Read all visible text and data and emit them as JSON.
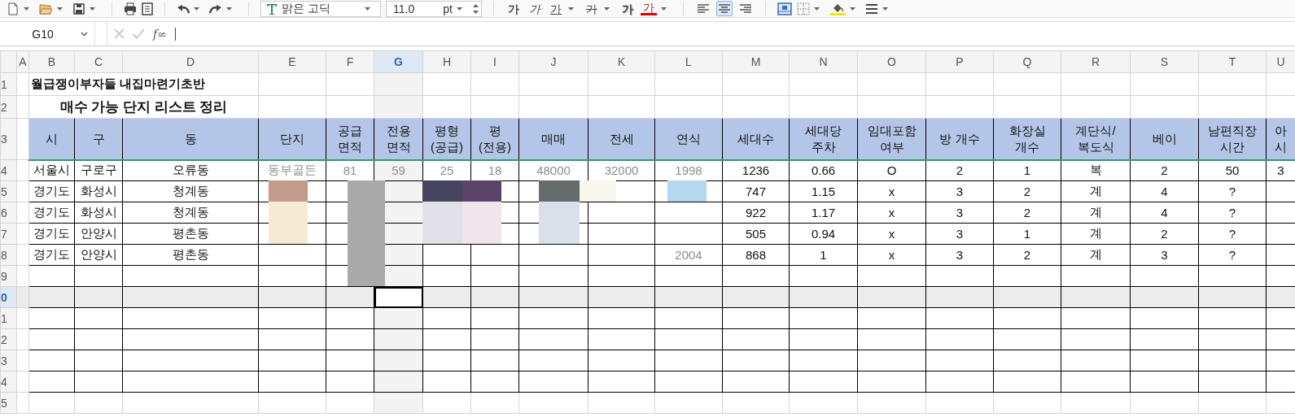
{
  "toolbar": {
    "font_name": "맑은 고딕",
    "font_size": "11.0",
    "size_unit": "pt",
    "text_style_buttons": [
      {
        "kind": "bold",
        "label": "가",
        "has_menu": false
      },
      {
        "kind": "italic",
        "label": "가",
        "has_menu": false
      },
      {
        "kind": "underline",
        "label": "가",
        "has_menu": true
      },
      {
        "kind": "strikethrough",
        "label": "가",
        "has_menu": true
      },
      {
        "kind": "shadow",
        "label": "가",
        "has_menu": false
      },
      {
        "kind": "font_color",
        "label": "가",
        "has_menu": true
      }
    ],
    "align_buttons": [
      {
        "kind": "left",
        "selected": false
      },
      {
        "kind": "center",
        "selected": true
      },
      {
        "kind": "right",
        "selected": false
      }
    ]
  },
  "formula_bar": {
    "cell_reference": "G10",
    "function_label": "f∞"
  },
  "sheet": {
    "columns": [
      {
        "label": "A",
        "selected": false
      },
      {
        "label": "B",
        "selected": false
      },
      {
        "label": "C",
        "selected": false
      },
      {
        "label": "D",
        "selected": false
      },
      {
        "label": "E",
        "selected": false
      },
      {
        "label": "F",
        "selected": false
      },
      {
        "label": "G",
        "selected": true
      },
      {
        "label": "H",
        "selected": false
      },
      {
        "label": "I",
        "selected": false
      },
      {
        "label": "J",
        "selected": false
      },
      {
        "label": "K",
        "selected": false
      },
      {
        "label": "L",
        "selected": false
      },
      {
        "label": "M",
        "selected": false
      },
      {
        "label": "N",
        "selected": false
      },
      {
        "label": "O",
        "selected": false
      },
      {
        "label": "P",
        "selected": false
      },
      {
        "label": "Q",
        "selected": false
      },
      {
        "label": "R",
        "selected": false
      },
      {
        "label": "S",
        "selected": false
      },
      {
        "label": "T",
        "selected": false
      },
      {
        "label": "U",
        "selected": false
      }
    ],
    "rows": [
      {
        "label": "1",
        "kind": "title",
        "selected": false,
        "cells": [
          null,
          "월급쟁이부자들 내집마련기초반",
          null,
          null,
          null,
          null,
          null,
          null,
          null,
          null,
          null,
          null,
          null,
          null,
          null,
          null,
          null,
          null,
          null,
          null,
          null
        ]
      },
      {
        "label": "2",
        "kind": "subtitle",
        "selected": false,
        "cells": [
          null,
          "매수 가능 단지 리스트 정리",
          null,
          null,
          null,
          null,
          null,
          null,
          null,
          null,
          null,
          null,
          null,
          null,
          null,
          null,
          null,
          null,
          null,
          null,
          null
        ]
      },
      {
        "label": "3",
        "kind": "header",
        "selected": false,
        "cells": [
          null,
          "시",
          "구",
          "동",
          "단지",
          "공급\n면적",
          "전용\n면적",
          "평형\n(공급)",
          "평\n(전용)",
          "매매",
          "전세",
          "연식",
          "세대수",
          "세대당\n주차",
          "임대포함\n여부",
          "방 개수",
          "화장실\n개수",
          "계단식/\n복도식",
          "베이",
          "남편직장\n시간",
          "아\n시"
        ]
      },
      {
        "label": "4",
        "kind": "data",
        "selected": false,
        "cells": [
          null,
          "서울시",
          "구로구",
          "오류동",
          {
            "text": "동부골든",
            "faded": true
          },
          {
            "text": "81",
            "faded": true
          },
          {
            "text": "59",
            "faded": true
          },
          {
            "text": "25",
            "faded": true
          },
          {
            "text": "18",
            "faded": true
          },
          {
            "text": "48000",
            "faded": true
          },
          {
            "text": "32000",
            "faded": true
          },
          {
            "text": "1998",
            "faded": true
          },
          "1236",
          "0.66",
          "O",
          "2",
          "1",
          "복",
          "2",
          "50",
          "3"
        ]
      },
      {
        "label": "5",
        "kind": "data",
        "selected": false,
        "cells": [
          null,
          "경기도",
          "화성시",
          "청계동",
          null,
          null,
          null,
          null,
          null,
          null,
          null,
          null,
          "747",
          "1.15",
          "x",
          "3",
          "2",
          "계",
          "4",
          "?",
          null
        ]
      },
      {
        "label": "6",
        "kind": "data",
        "selected": false,
        "cells": [
          null,
          "경기도",
          "화성시",
          "청계동",
          null,
          null,
          null,
          null,
          null,
          null,
          null,
          null,
          "922",
          "1.17",
          "x",
          "3",
          "2",
          "계",
          "4",
          "?",
          null
        ]
      },
      {
        "label": "7",
        "kind": "data",
        "selected": false,
        "cells": [
          null,
          "경기도",
          "안양시",
          "평촌동",
          null,
          null,
          null,
          null,
          null,
          null,
          null,
          null,
          "505",
          "0.94",
          "x",
          "3",
          "1",
          "계",
          "2",
          "?",
          null
        ]
      },
      {
        "label": "8",
        "kind": "data",
        "selected": false,
        "cells": [
          null,
          "경기도",
          "안양시",
          "평촌동",
          null,
          null,
          null,
          null,
          null,
          null,
          null,
          {
            "text": "2004",
            "faded": true
          },
          "868",
          "1",
          "x",
          "3",
          "2",
          "계",
          "3",
          "?",
          null
        ]
      },
      {
        "label": "9",
        "kind": "empty",
        "selected": false
      },
      {
        "label": "0",
        "kind": "empty",
        "selected": true
      },
      {
        "label": "1",
        "kind": "empty",
        "selected": false
      },
      {
        "label": "2",
        "kind": "empty",
        "selected": false
      },
      {
        "label": "3",
        "kind": "empty",
        "selected": false
      },
      {
        "label": "4",
        "kind": "empty",
        "selected": false
      },
      {
        "label": "5",
        "kind": "blank",
        "selected": false
      }
    ]
  }
}
